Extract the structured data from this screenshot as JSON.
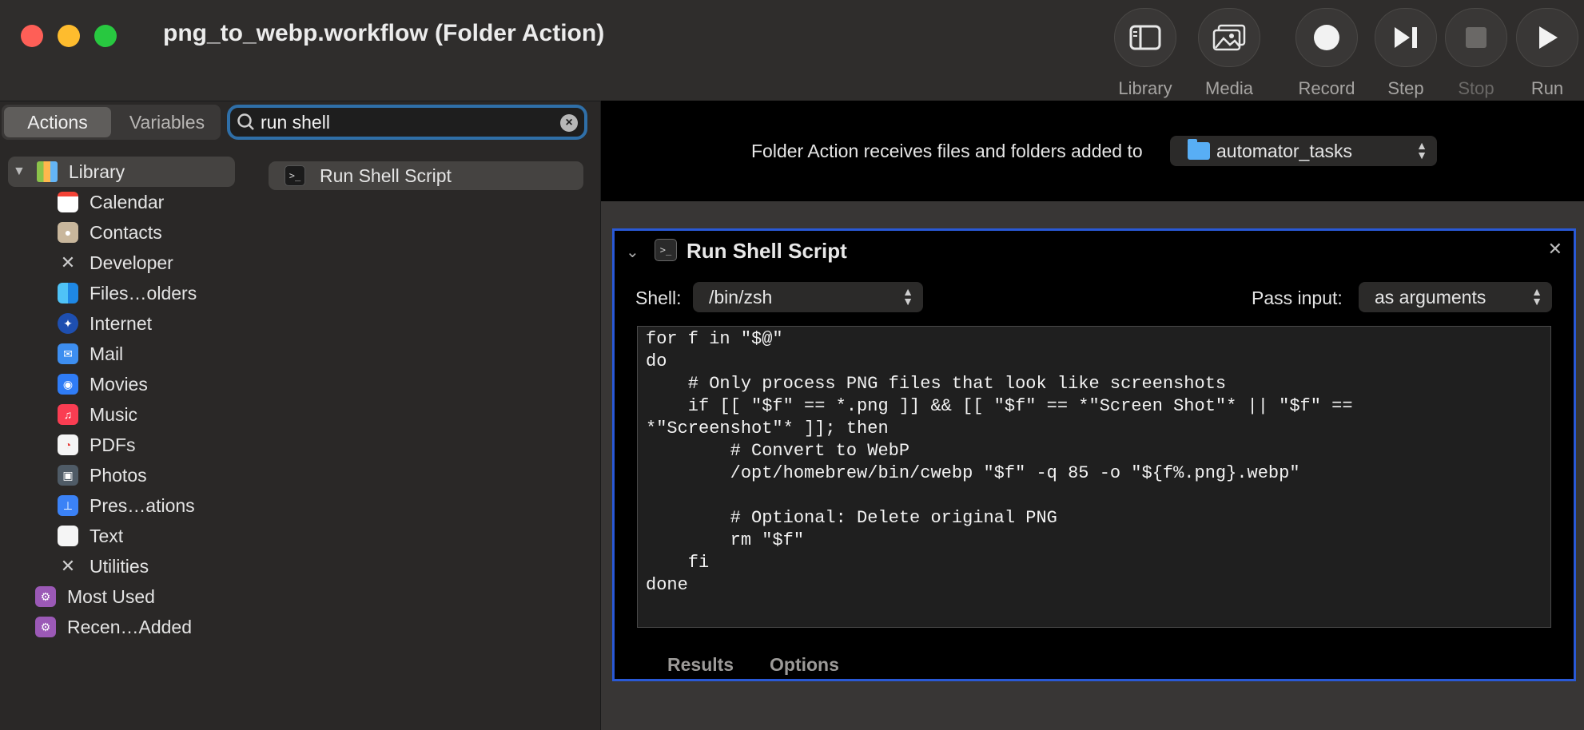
{
  "window": {
    "title": "png_to_webp.workflow (Folder Action)"
  },
  "toolbar": {
    "buttons": [
      {
        "label": "Library",
        "icon": "sidebar-icon",
        "enabled": true
      },
      {
        "label": "Media",
        "icon": "photos-icon",
        "enabled": true
      },
      {
        "label": "Record",
        "icon": "record-icon",
        "enabled": true
      },
      {
        "label": "Step",
        "icon": "step-icon",
        "enabled": true
      },
      {
        "label": "Stop",
        "icon": "stop-icon",
        "enabled": false
      },
      {
        "label": "Run",
        "icon": "play-icon",
        "enabled": true
      }
    ]
  },
  "sidebar": {
    "segments": {
      "actions": "Actions",
      "variables": "Variables",
      "selected": "Actions"
    },
    "search": {
      "value": "run shell"
    },
    "library": {
      "label": "Library",
      "items": [
        {
          "label": "Calendar",
          "icon": "calendar-icon"
        },
        {
          "label": "Contacts",
          "icon": "contacts-icon"
        },
        {
          "label": "Developer",
          "icon": "developer-icon"
        },
        {
          "label": "Files…olders",
          "icon": "finder-icon"
        },
        {
          "label": "Internet",
          "icon": "internet-icon"
        },
        {
          "label": "Mail",
          "icon": "mail-icon"
        },
        {
          "label": "Movies",
          "icon": "movies-icon"
        },
        {
          "label": "Music",
          "icon": "music-icon"
        },
        {
          "label": "PDFs",
          "icon": "pdf-icon"
        },
        {
          "label": "Photos",
          "icon": "photos-icon"
        },
        {
          "label": "Pres…ations",
          "icon": "presentations-icon"
        },
        {
          "label": "Text",
          "icon": "text-icon"
        },
        {
          "label": "Utilities",
          "icon": "utilities-icon"
        }
      ]
    },
    "smart_groups": [
      {
        "label": "Most Used",
        "icon": "smart-folder-icon"
      },
      {
        "label": "Recen…Added",
        "icon": "smart-folder-icon"
      }
    ],
    "results": [
      {
        "label": "Run Shell Script",
        "icon": "terminal-icon"
      }
    ]
  },
  "workflow": {
    "receives_label": "Folder Action receives files and folders added to",
    "folder": "automator_tasks",
    "action": {
      "title": "Run Shell Script",
      "shell_label": "Shell:",
      "shell_value": "/bin/zsh",
      "pass_input_label": "Pass input:",
      "pass_input_value": "as arguments",
      "script": "for f in \"$@\"\ndo\n    # Only process PNG files that look like screenshots\n    if [[ \"$f\" == *.png ]] && [[ \"$f\" == *\"Screen Shot\"* || \"$f\" ==\n*\"Screenshot\"* ]]; then\n        # Convert to WebP\n        /opt/homebrew/bin/cwebp \"$f\" -q 85 -o \"${f%.png}.webp\"\n\n        # Optional: Delete original PNG\n        rm \"$f\"\n    fi\ndone",
      "tabs": [
        "Results",
        "Options"
      ]
    }
  },
  "colors": {
    "accent": "#2959d6",
    "search_focus": "#2f6fa8",
    "close": "#fe5f57",
    "minimize": "#febc2e",
    "maximize": "#28c840"
  }
}
